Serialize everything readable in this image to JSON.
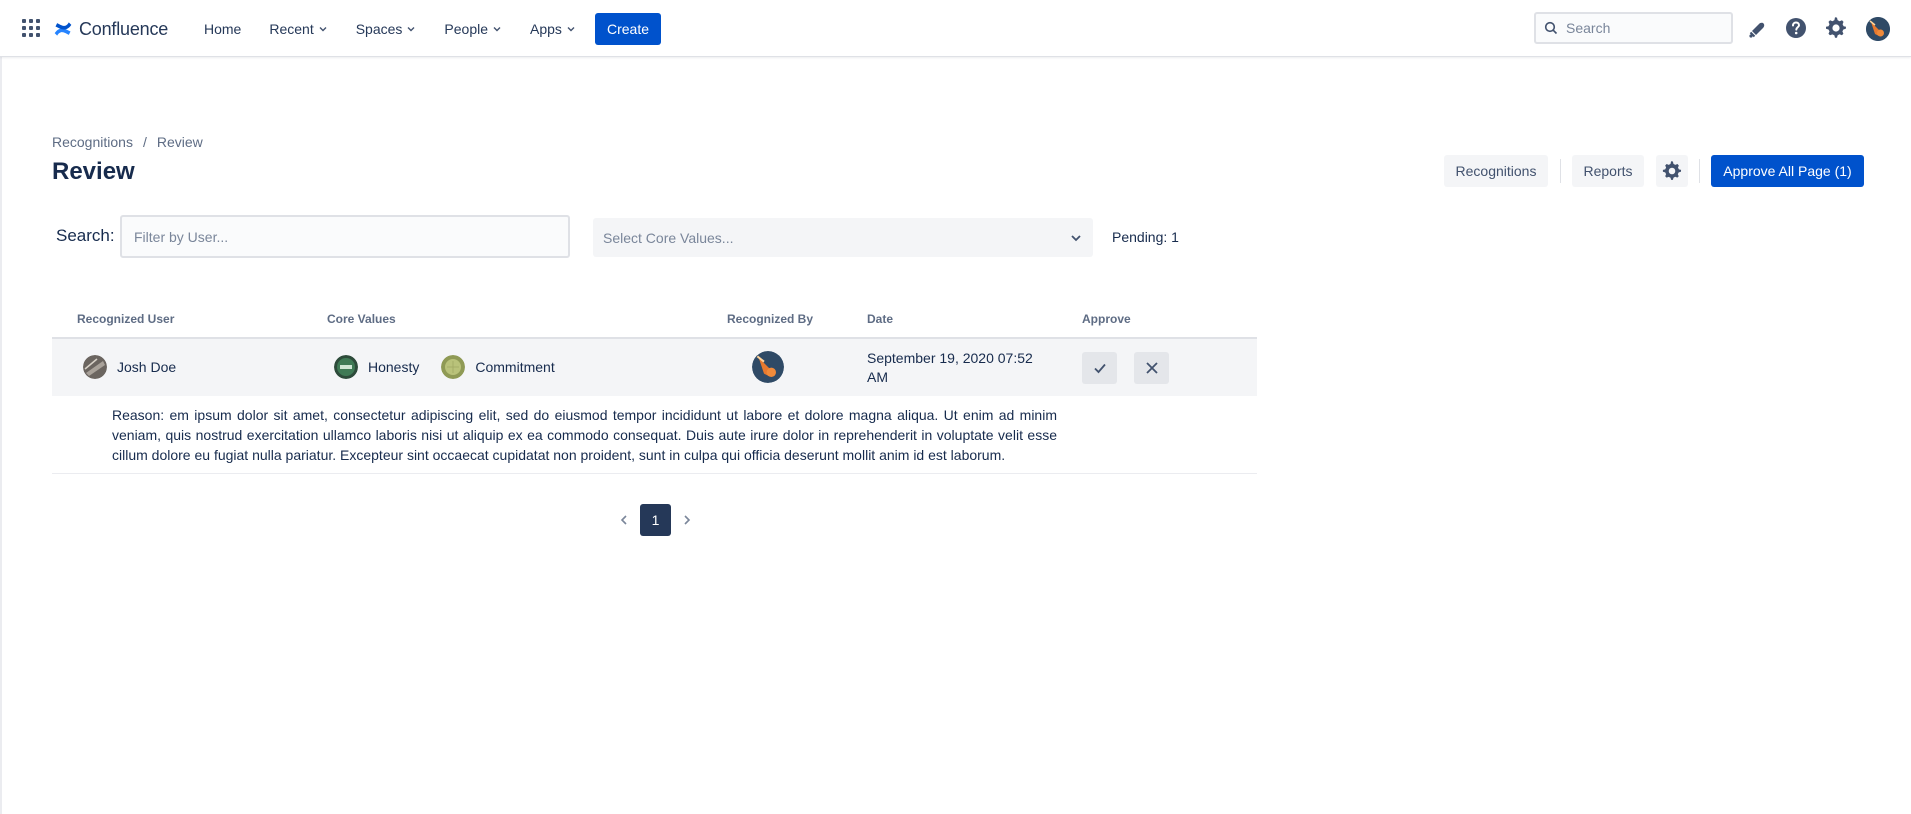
{
  "topnav": {
    "logo_text": "Confluence",
    "items": [
      {
        "label": "Home",
        "dropdown": false
      },
      {
        "label": "Recent",
        "dropdown": true
      },
      {
        "label": "Spaces",
        "dropdown": true
      },
      {
        "label": "People",
        "dropdown": true
      },
      {
        "label": "Apps",
        "dropdown": true
      }
    ],
    "create_label": "Create",
    "search_placeholder": "Search",
    "icons": [
      "notifications-icon",
      "help-icon",
      "settings-icon",
      "profile-avatar"
    ]
  },
  "breadcrumb": {
    "items": [
      "Recognitions",
      "Review"
    ],
    "separator": "/"
  },
  "page": {
    "title": "Review",
    "buttons": {
      "recognitions": "Recognitions",
      "reports": "Reports",
      "approve_all": "Approve All Page (1)"
    }
  },
  "filters": {
    "search_label": "Search:",
    "user_placeholder": "Filter by User...",
    "core_values_placeholder": "Select Core Values...",
    "pending_text": "Pending: 1"
  },
  "table": {
    "headers": {
      "recognized_user": "Recognized User",
      "core_values": "Core Values",
      "recognized_by": "Recognized By",
      "date": "Date",
      "approve": "Approve"
    },
    "rows": [
      {
        "recognized_user": "Josh Doe",
        "core_values": [
          "Honesty",
          "Commitment"
        ],
        "date": "September 19, 2020 07:52 AM",
        "reason": "Reason: em ipsum dolor sit amet, consectetur adipiscing elit, sed do eiusmod tempor incididunt ut labore et dolore magna aliqua. Ut enim ad minim veniam, quis nostrud exercitation ullamco laboris nisi ut aliquip ex ea commodo consequat. Duis aute irure dolor in reprehenderit in voluptate velit esse cillum dolore eu fugiat nulla pariatur. Excepteur sint occaecat cupidatat non proident, sunt in culpa qui officia deserunt mollit anim id est laborum."
      }
    ]
  },
  "pagination": {
    "current_page": "1"
  },
  "colors": {
    "primary": "#0052cc",
    "text": "#172b4d",
    "subtle": "#5e6c84",
    "row_bg": "#f4f5f7",
    "pager_active": "#253858"
  }
}
